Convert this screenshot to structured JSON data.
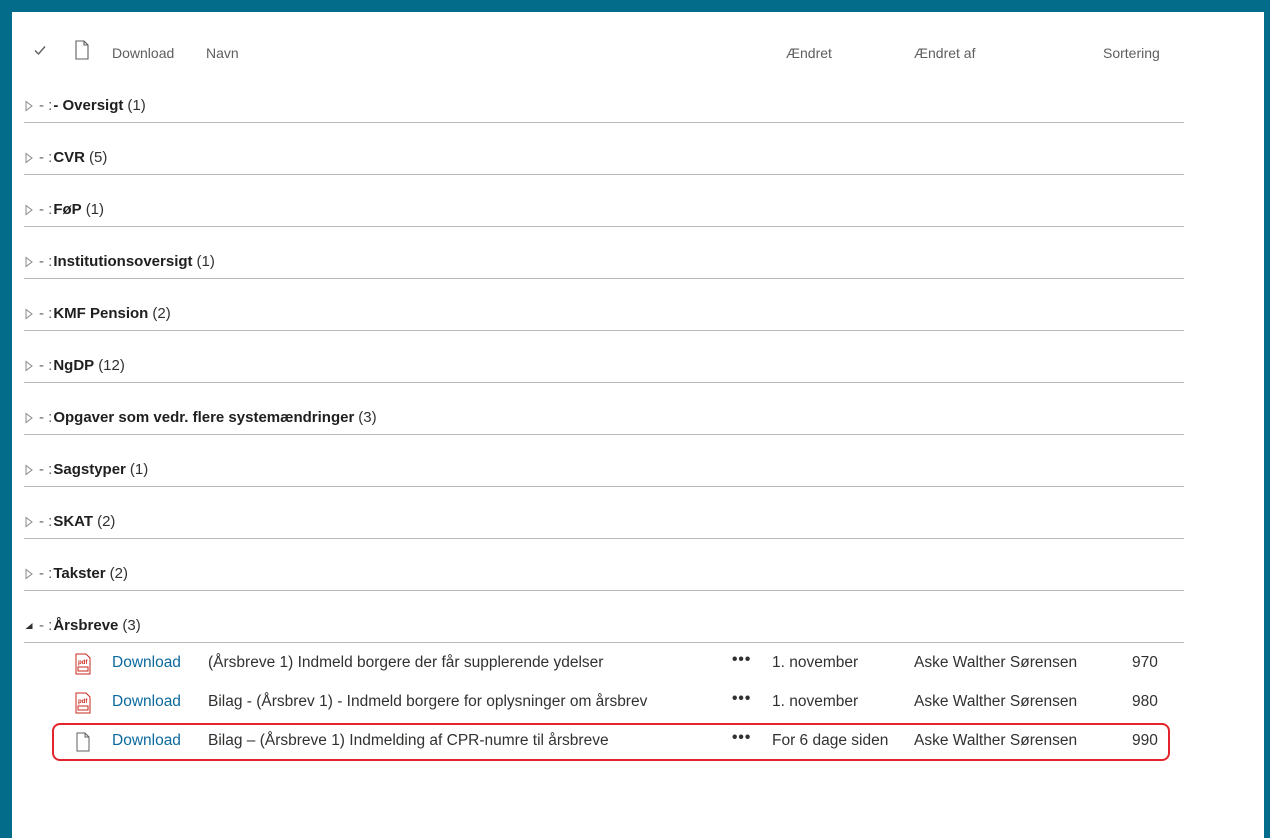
{
  "header": {
    "download": "Download",
    "navn": "Navn",
    "aendret": "Ændret",
    "aendret_af": "Ændret af",
    "sortering": "Sortering"
  },
  "group_prefix": "- :",
  "groups": [
    {
      "label": "- Oversigt",
      "count": "(1)",
      "expanded": false
    },
    {
      "label": "CVR",
      "count": "(5)",
      "expanded": false
    },
    {
      "label": "FøP",
      "count": "(1)",
      "expanded": false
    },
    {
      "label": "Institutionsoversigt",
      "count": "(1)",
      "expanded": false
    },
    {
      "label": "KMF Pension",
      "count": "(2)",
      "expanded": false
    },
    {
      "label": "NgDP",
      "count": "(12)",
      "expanded": false
    },
    {
      "label": "Opgaver som vedr. flere systemændringer",
      "count": "(3)",
      "expanded": false
    },
    {
      "label": "Sagstyper",
      "count": "(1)",
      "expanded": false
    },
    {
      "label": "SKAT",
      "count": "(2)",
      "expanded": false
    },
    {
      "label": "Takster",
      "count": "(2)",
      "expanded": false
    },
    {
      "label": "Årsbreve",
      "count": "(3)",
      "expanded": true
    }
  ],
  "files": [
    {
      "icon": "pdf-icon",
      "download": "Download",
      "name": "(Årsbreve 1) Indmeld borgere der får supplerende ydelser",
      "more": "•••",
      "modified": "1. november",
      "modified_by": "Aske Walther Sørensen",
      "sort": "970"
    },
    {
      "icon": "pdf-icon",
      "download": "Download",
      "name": "Bilag - (Årsbrev 1) - Indmeld borgere for oplysninger om årsbrev",
      "more": "•••",
      "modified": "1. november",
      "modified_by": "Aske Walther Sørensen",
      "sort": "980"
    },
    {
      "icon": "document-icon",
      "download": "Download",
      "name": "Bilag – (Årsbreve 1) Indmelding af CPR-numre til årsbreve",
      "more": "•••",
      "modified": "For 6 dage siden",
      "modified_by": "Aske Walther Sørensen",
      "sort": "990"
    }
  ],
  "colors": {
    "frame": "#036c8a",
    "link": "#0b6a9e",
    "highlight": "#e3242b",
    "pdf": "#c8281e"
  }
}
